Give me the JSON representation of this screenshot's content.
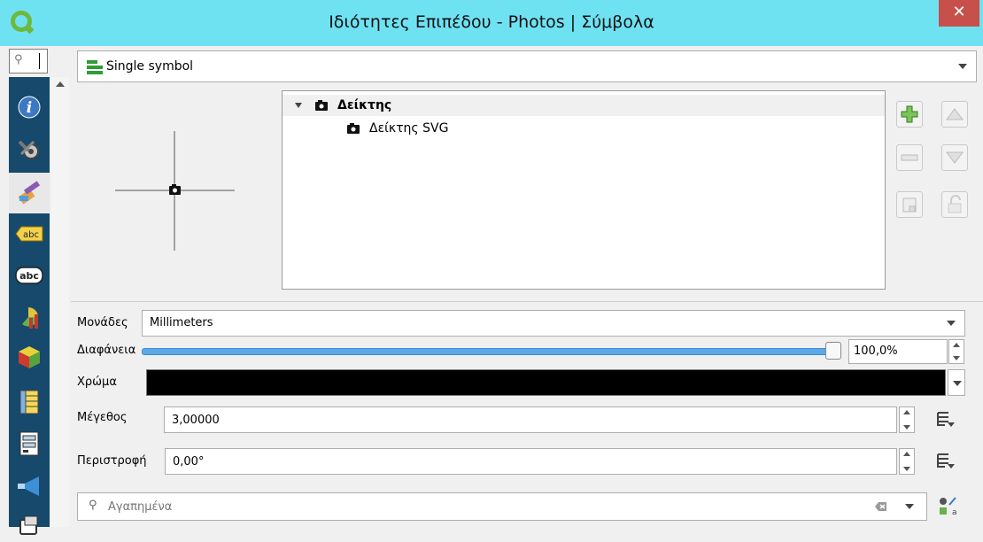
{
  "window": {
    "title": "Ιδιότητες Επιπέδου - Photos | Σύμβολα",
    "close_glyph": "✕"
  },
  "sidebar": {
    "search_icon": "search-icon",
    "tabs": [
      {
        "icon": "info-icon"
      },
      {
        "icon": "source-settings-icon"
      },
      {
        "icon": "symbology-brush-icon"
      },
      {
        "icon": "labels-abc-icon"
      },
      {
        "icon": "labels-abc-outline-icon"
      },
      {
        "icon": "diagrams-icon"
      },
      {
        "icon": "3d-view-icon"
      },
      {
        "icon": "fields-icon"
      },
      {
        "icon": "attributes-form-icon"
      },
      {
        "icon": "joins-icon"
      },
      {
        "icon": "auxiliary-storage-icon"
      }
    ]
  },
  "renderer": {
    "selected": "Single symbol"
  },
  "symbol_tree": {
    "root_label": "Δείκτης",
    "child_label": "Δείκτης SVG"
  },
  "properties": {
    "units_label": "Μονάδες",
    "units_value": "Millimeters",
    "opacity_label": "Διαφάνεια",
    "opacity_value": "100,0%",
    "opacity_fraction": 1.0,
    "color_label": "Χρώμα",
    "color_value": "#000000",
    "size_label": "Μέγεθος",
    "size_value": "3,00000",
    "rotation_label": "Περιστροφή",
    "rotation_value": "0,00°"
  },
  "library": {
    "search_placeholder": "Αγαπημένα"
  }
}
